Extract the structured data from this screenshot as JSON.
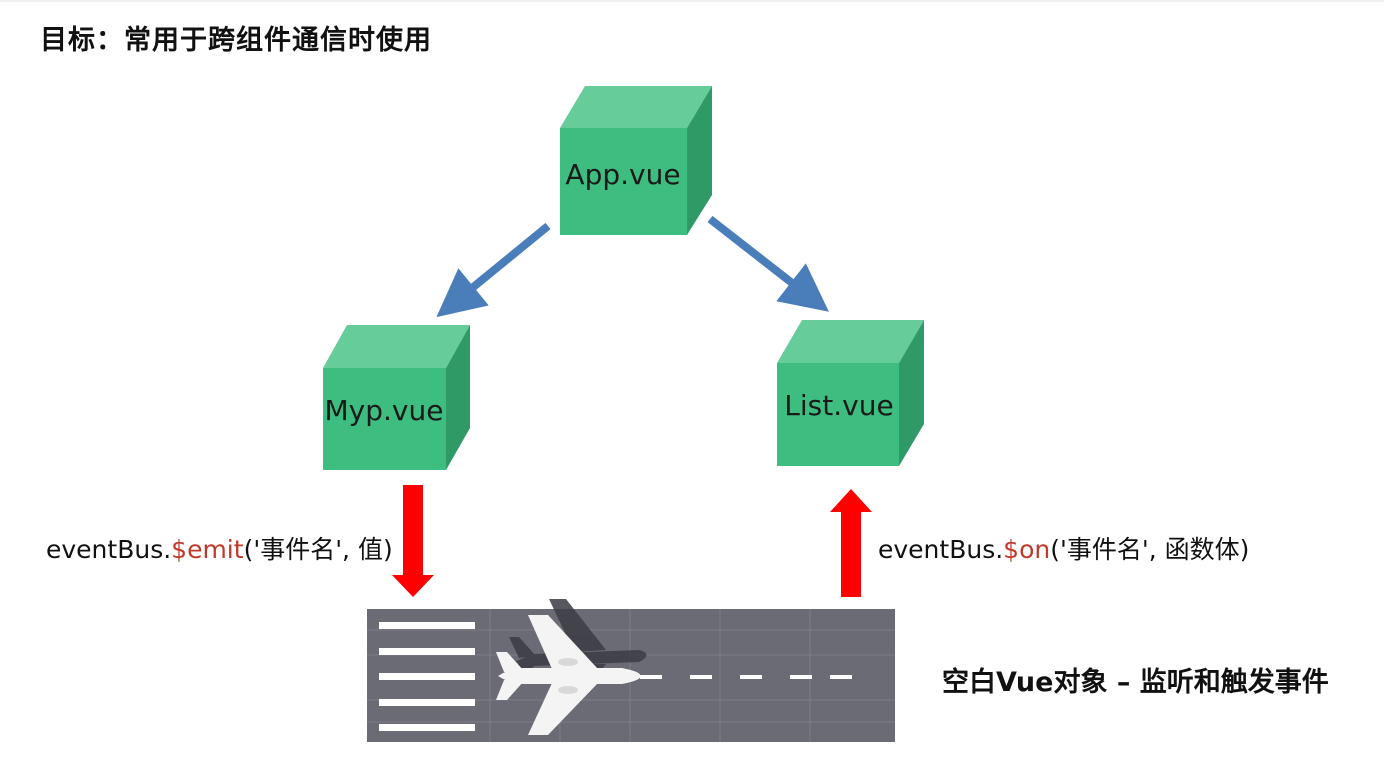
{
  "title": "目标：常用于跨组件通信时使用",
  "nodes": {
    "app": "App.vue",
    "myp": "Myp.vue",
    "list": "List.vue"
  },
  "emit_label": {
    "prefix": "eventBus.",
    "method": "$emit",
    "args": "('事件名', 值)"
  },
  "on_label": {
    "prefix": "eventBus.",
    "method": "$on",
    "args": "('事件名', 函数体)"
  },
  "bus_caption": "空白Vue对象 – 监听和触发事件",
  "colors": {
    "cube_front": "#3dbd80",
    "cube_top": "#66cc99",
    "cube_side": "#2f9a66",
    "blue_arrow": "#4a7ebb",
    "red_arrow": "#ff0000",
    "method_text": "#c0392b",
    "runway": "#6a6b75"
  }
}
